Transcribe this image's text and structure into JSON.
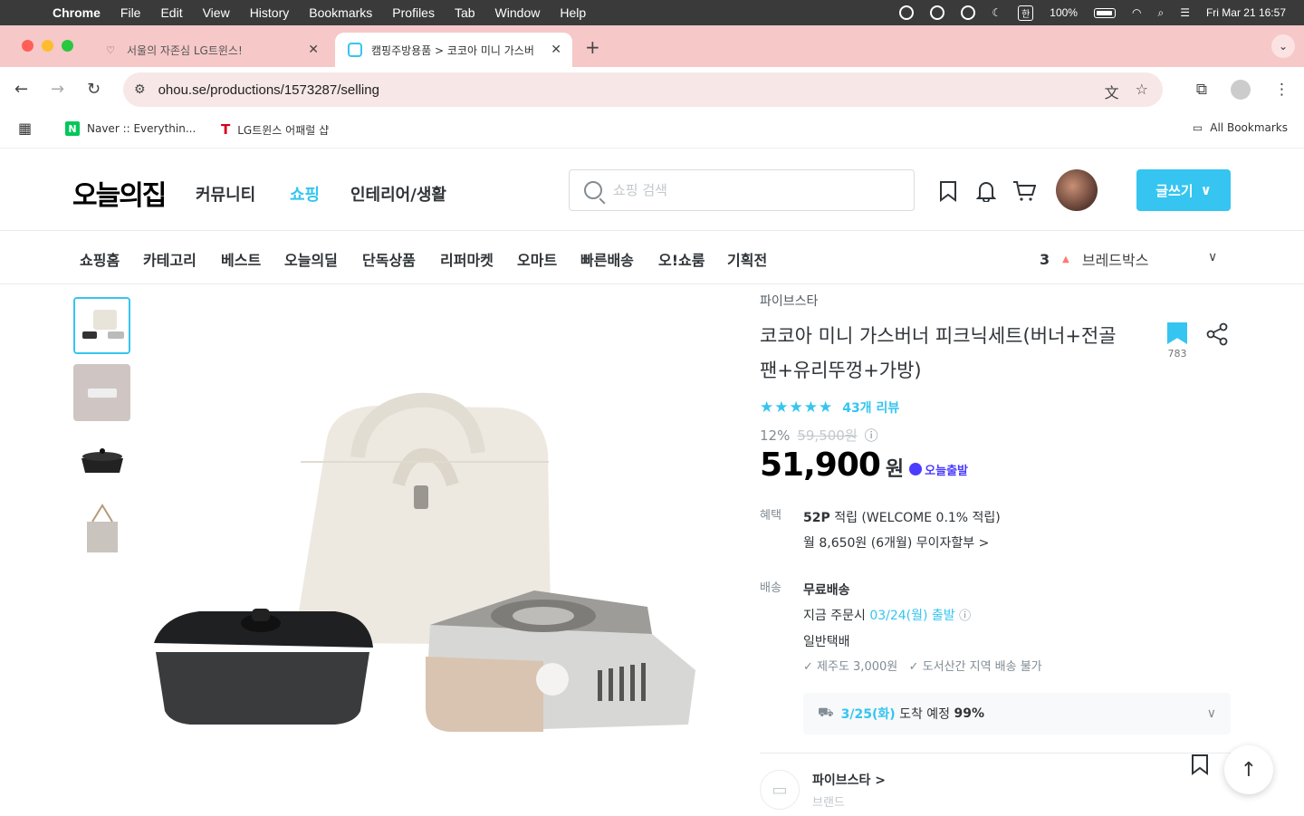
{
  "menubar": {
    "app": "Chrome",
    "items": [
      "File",
      "Edit",
      "View",
      "History",
      "Bookmarks",
      "Profiles",
      "Tab",
      "Window",
      "Help"
    ],
    "status": {
      "input_method": "한",
      "battery": "100%",
      "datetime": "Fri Mar 21  16:57"
    }
  },
  "tabs": [
    {
      "title": "서울의 자존심 LG트윈스!",
      "active": false
    },
    {
      "title": "캠핑주방용품 > 코코아 미니 가스버",
      "active": true
    }
  ],
  "toolbar": {
    "url": "ohou.se/productions/1573287/selling"
  },
  "bookmarks": {
    "items": [
      {
        "label": "Naver :: Everythin...",
        "icon": "naver-icon"
      },
      {
        "label": "LG트윈스 어패럴 샵",
        "icon": "twins-icon"
      }
    ],
    "all_label": "All Bookmarks"
  },
  "site": {
    "logo": "오늘의집",
    "gnb": [
      "커뮤니티",
      "쇼핑",
      "인테리어/생활"
    ],
    "search_placeholder": "쇼핑 검색",
    "write_button": "글쓰기"
  },
  "subnav": {
    "items": [
      "쇼핑홈",
      "카테고리",
      "베스트",
      "오늘의딜",
      "단독상품",
      "리퍼마켓",
      "오마트",
      "빠른배송",
      "오!쇼룸",
      "기획전"
    ],
    "ranking": {
      "rank": "3",
      "keyword": "브레드박스"
    }
  },
  "product": {
    "brand": "파이브스타",
    "title": "코코아 미니 가스버너 피크닉세트(버너+전골팬+유리뚜껑+가방)",
    "scrap_count": "783",
    "rating_stars": "★★★★★",
    "review_label": "43개 리뷰",
    "discount_rate": "12%",
    "original_price": "59,500원",
    "price": "51,900",
    "currency": "원",
    "badge": "오늘출발",
    "benefit_label": "혜택",
    "points": "52P",
    "points_text": "적립 (WELCOME 0.1% 적립)",
    "installment": "월 8,650원 (6개월) 무이자할부 >",
    "delivery_label": "배송",
    "delivery_fee": "무료배송",
    "order_prefix": "지금 주문시",
    "ship_date": "03/24(월) 출발",
    "carrier": "일반택배",
    "notice1": "✓ 제주도 3,000원",
    "notice2": "✓ 도서산간 지역 배송 불가",
    "eta_date": "3/25(화)",
    "eta_text": "도착 예정",
    "eta_pct": "99%"
  },
  "seller": {
    "name": "파이브스타 >",
    "type": "브랜드"
  }
}
